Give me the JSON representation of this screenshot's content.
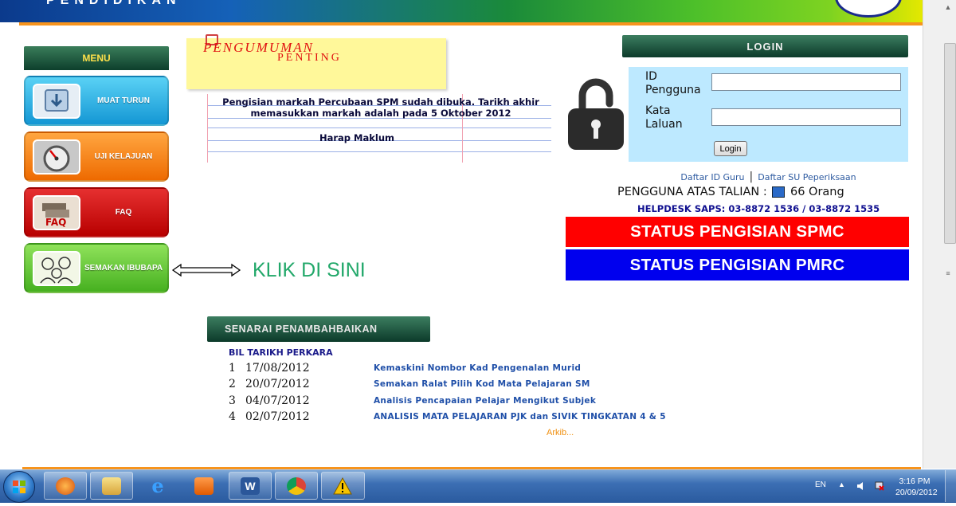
{
  "header": {
    "title": "PENDIDIKAN"
  },
  "menu": {
    "title": "MENU",
    "items": [
      {
        "label": "MUAT TURUN",
        "icon": "download-icon"
      },
      {
        "label": "UJI KELAJUAN",
        "icon": "speedometer-icon"
      },
      {
        "label": "FAQ",
        "icon": "faq-icon"
      },
      {
        "label": "SEMAKAN IBUBAPA",
        "icon": "parents-icon"
      }
    ]
  },
  "callout": {
    "text": "KLIK DI SINI"
  },
  "announcement": {
    "title_line1": "PENGUMUMAN",
    "title_line2": "PENTING",
    "body": "Pengisian markah Percubaan SPM sudah dibuka. Tarikh akhir memasukkan markah adalah pada 5 Oktober 2012",
    "closing": "Harap Maklum"
  },
  "updates": {
    "title": "SENARAI PENAMBAHBAIKAN",
    "columns": "BIL TARIKH PERKARA",
    "rows": [
      {
        "bil": "1",
        "date": "17/08/2012",
        "item": "Kemaskini Nombor Kad Pengenalan Murid"
      },
      {
        "bil": "2",
        "date": "20/07/2012",
        "item": "Semakan Ralat Pilih Kod Mata Pelajaran SM"
      },
      {
        "bil": "3",
        "date": "04/07/2012",
        "item": "Analisis Pencapaian Pelajar Mengikut Subjek"
      },
      {
        "bil": "4",
        "date": "02/07/2012",
        "item": "ANALISIS MATA PELAJARAN PJK dan SIVIK TINGKATAN 4 & 5"
      }
    ],
    "archive": "Arkib..."
  },
  "login": {
    "title": "LOGIN",
    "id_label_1": "ID",
    "id_label_2": "Pengguna",
    "pw_label_1": "Kata",
    "pw_label_2": "Laluan",
    "id_value": "",
    "pw_value": "",
    "button": "Login",
    "link_daftar_guru": "Daftar ID Guru",
    "link_daftar_su": "Daftar SU Peperiksaan",
    "online_label": "PENGGUNA ATAS TALIAN :",
    "online_count": "66 Orang",
    "helpdesk": "HELPDESK SAPS: 03-8872 1536 / 03-8872 1535"
  },
  "status": {
    "spmc": "STATUS PENGISIAN SPMC",
    "pmrc": "STATUS PENGISIAN PMRC"
  },
  "taskbar": {
    "apps": [
      "firefox-icon",
      "explorer-icon",
      "internet-explorer-icon",
      "media-player-icon",
      "word-icon",
      "chrome-icon",
      "warning-icon"
    ],
    "language": "EN",
    "time": "3:16 PM",
    "date": "20/09/2012"
  },
  "colors": {
    "accent_orange": "#f7941d",
    "status_red": "#ff0000",
    "status_blue": "#0000ee",
    "login_bg": "#bde9ff",
    "callout_green": "#22a86a"
  }
}
